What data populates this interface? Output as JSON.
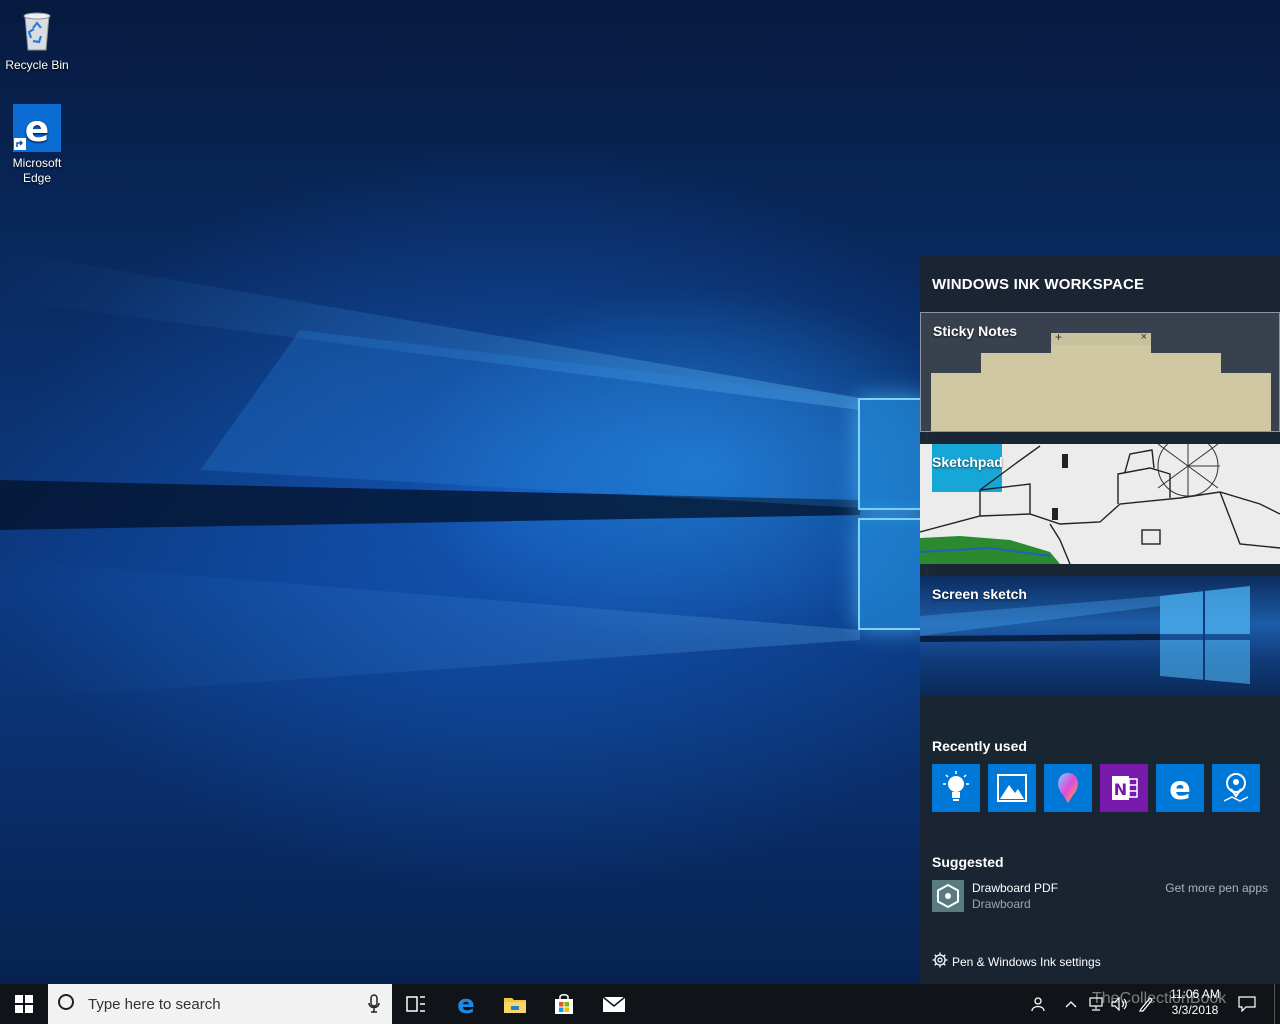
{
  "desktop": {
    "icons": [
      {
        "label": "Recycle Bin",
        "icon": "recycle-bin-icon"
      },
      {
        "label": "Microsoft\nEdge",
        "icon": "edge-icon"
      }
    ]
  },
  "ink_workspace": {
    "title": "WINDOWS INK WORKSPACE",
    "tiles": {
      "sticky_notes": "Sticky Notes",
      "sketchpad": "Sketchpad",
      "screen_sketch": "Screen sketch"
    },
    "recently_used": {
      "title": "Recently used",
      "apps": [
        {
          "name": "tips-lightbulb-icon",
          "color": "#0078d7"
        },
        {
          "name": "photos-icon",
          "color": "#0078d7"
        },
        {
          "name": "paint-3d-icon",
          "color": "#0078d7"
        },
        {
          "name": "onenote-icon",
          "color": "#7719aa"
        },
        {
          "name": "edge-icon",
          "color": "#0078d7"
        },
        {
          "name": "maps-icon",
          "color": "#0078d7"
        }
      ]
    },
    "suggested": {
      "title": "Suggested",
      "app_name": "Drawboard PDF",
      "publisher": "Drawboard",
      "get_more": "Get more pen apps"
    },
    "settings_link": "Pen & Windows Ink settings"
  },
  "taskbar": {
    "search_placeholder": "Type here to search",
    "pinned": [
      "task-view-icon",
      "edge-icon",
      "file-explorer-icon",
      "store-icon",
      "mail-icon"
    ],
    "clock": {
      "time": "11:06 AM",
      "date": "3/3/2018"
    },
    "watermark": "TheCollectionBook"
  },
  "colors": {
    "accent": "#0078d7",
    "panel": "#1b2430",
    "taskbar": "#101419"
  }
}
